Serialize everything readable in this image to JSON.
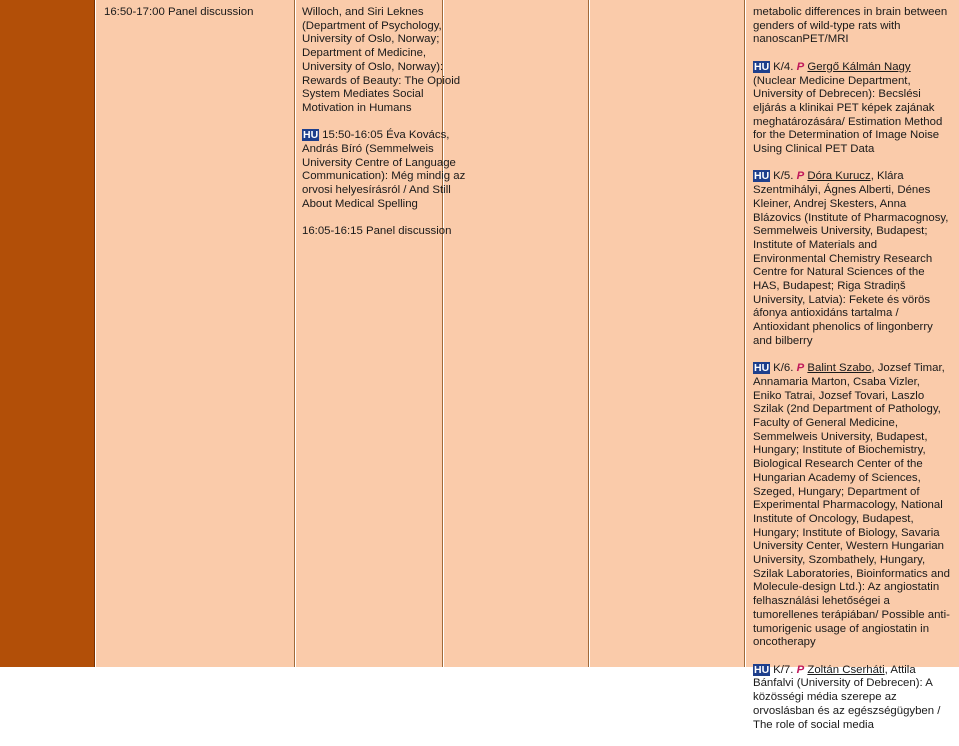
{
  "time_cell": "16:50-17:00 Panel discussion",
  "hu_label": "HU",
  "p_label": "P",
  "col2": {
    "entry1": "Willoch, and Siri Leknes (Department of Psychology, University of Oslo, Norway; Department of Medicine, University of Oslo, Norway): Rewards of Beauty: The Opioid System Mediates Social Motivation in Humans",
    "entry2": "15:50-16:05 Éva Kovács, András Bíró (Semmelweis University Centre of Language Communication): Még mindig az orvosi helyesírásról / And Still About Medical Spelling",
    "entry3": "16:05-16:15 Panel discussion"
  },
  "col5": {
    "entry0": "metabolic differences in brain between genders of wild-type rats with nanoscanPET/MRI",
    "k4_code": "K/4.",
    "k4_author": "Gergő Kálmán Nagy",
    "k4_rest": "(Nuclear Medicine Department, University of Debrecen): Becslési eljárás a klinikai PET képek zajának meghatározására/ Estimation Method for the Determination of Image Noise Using Clinical PET Data",
    "k5_code": "K/5.",
    "k5_author": "Dóra Kurucz",
    "k5_rest": ", Klára Szentmihályi, Ágnes Alberti, Dénes Kleiner, Andrej Skesters, Anna Blázovics (Institute of Pharmacognosy, Semmelweis University, Budapest; Institute of Materials and Environmental Chemistry Research Centre for Natural Sciences of the HAS, Budapest; Riga Stradiņš University, Latvia): Fekete és vörös áfonya antioxidáns tartalma / Antioxidant phenolics of lingonberry and bilberry",
    "k6_code": "K/6.",
    "k6_author": "Balint Szabo",
    "k6_rest": ", Jozsef Timar, Annamaria Marton, Csaba Vizler, Eniko Tatrai, Jozsef Tovari, Laszlo Szilak (2nd Department of Pathology, Faculty of General Medicine, Semmelweis University, Budapest, Hungary; Institute of Biochemistry, Biological Research Center of the Hungarian Academy of Sciences, Szeged, Hungary; Department of Experimental Pharmacology, National Institute of Oncology, Budapest, Hungary; Institute of Biology, Savaria University Center, Western Hungarian University, Szombathely, Hungary, Szilak Laboratories, Bioinformatics and Molecule-design Ltd.): Az angiostatin felhasználási lehetőségei a tumorellenes terápiában/ Possible anti-tumorigenic usage of angiostatin in oncotherapy",
    "k7_code": "K/7.",
    "k7_author": "Zoltán Cserháti",
    "k7_rest": ", Attila Bánfalvi (University of Debrecen): A közösségi média szerepe az orvoslásban és az egészségügyben / The role of social media"
  }
}
